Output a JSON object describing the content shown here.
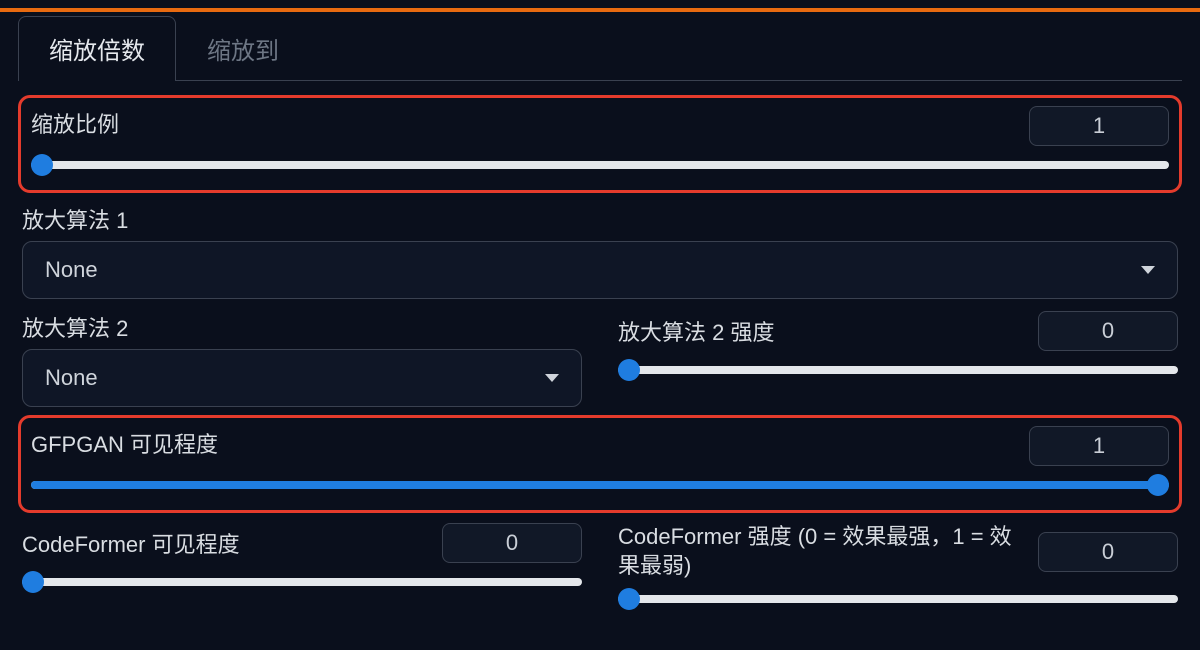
{
  "tabs": {
    "scale_by": "缩放倍数",
    "scale_to": "缩放到"
  },
  "scale_ratio": {
    "label": "缩放比例",
    "value": "1"
  },
  "upscaler1": {
    "label": "放大算法 1",
    "selected": "None"
  },
  "upscaler2": {
    "label": "放大算法 2",
    "selected": "None"
  },
  "upscaler2_strength": {
    "label": "放大算法 2 强度",
    "value": "0"
  },
  "gfpgan": {
    "label": "GFPGAN 可见程度",
    "value": "1"
  },
  "codeformer_vis": {
    "label": "CodeFormer 可见程度",
    "value": "0"
  },
  "codeformer_strength": {
    "label": "CodeFormer 强度 (0 = 效果最强，1 = 效果最弱)",
    "value": "0"
  }
}
